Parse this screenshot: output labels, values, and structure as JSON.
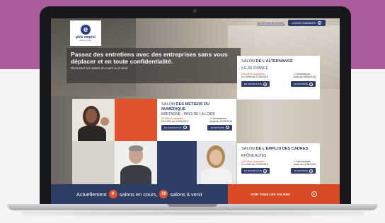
{
  "header": {
    "recruiter_link": "ACCÈS RECRUTEURS ›",
    "candidate_button": "ACCÈS CANDIDATS"
  },
  "logo": {
    "mark": "e",
    "name": "pôle emploi",
    "subtitle": "salons en ligne"
  },
  "hero": {
    "title": "Passez des entretiens avec des entreprises sans vous déplacer et en toute confidentialité.",
    "subtitle": "Découvrez les salons en cours ou à venir."
  },
  "cards": [
    {
      "title_prefix": "SALON ",
      "title_bold": "DE L'ALTERNANCE",
      "region": "ILE DE FRANCE",
      "offers_count": "208 offres proposées",
      "offers_dates": "Du 15/05 au 07/06/2015",
      "applications_label": "// Candidatures",
      "applications_until": "jusqu'au 05/06/2015",
      "more_button": "EN SAVOIR PLUS",
      "participate_button": "JE PARTICIPE"
    },
    {
      "title_prefix": "SALON ",
      "title_bold": "DES MÉTIERS DU NUMÉRIQUE",
      "region": "BRETAGNE - PAYS DE LA LOIRE",
      "offers_count": "80 offres proposées",
      "offers_dates": "Du 27/04 au 13/05/2015",
      "applications_label": "// Candidatures",
      "applications_until": "jusqu'au 10/05/2015",
      "more_button": "EN SAVOIR PLUS",
      "participate_button": "JE PARTICIPE"
    },
    {
      "title_prefix": "SALON ",
      "title_bold": "DE L'EMPLOI DES CADRES",
      "region": "RHÔNE ALPES",
      "offers_count": "135 offres proposées",
      "offers_dates": "Du 01/06 au 13/06/2015",
      "applications_label": "// Candidatures",
      "applications_until": "jusqu'au 11/06/2015",
      "more_button": "EN SAVOIR PLUS",
      "participate_button": "JE PARTICIPE"
    }
  ],
  "bottom_bar": {
    "prefix": "Actuellement",
    "current_count": "6",
    "middle": "salons en cours,",
    "upcoming_count": "10",
    "suffix": "salons à venir",
    "cta": "VOIR TOUS LES SALONS"
  },
  "colors": {
    "brand_navy": "#2e3d66",
    "accent_orange": "#d94b26",
    "background_purple": "#a85c9b",
    "card_white": "#ffffff"
  }
}
